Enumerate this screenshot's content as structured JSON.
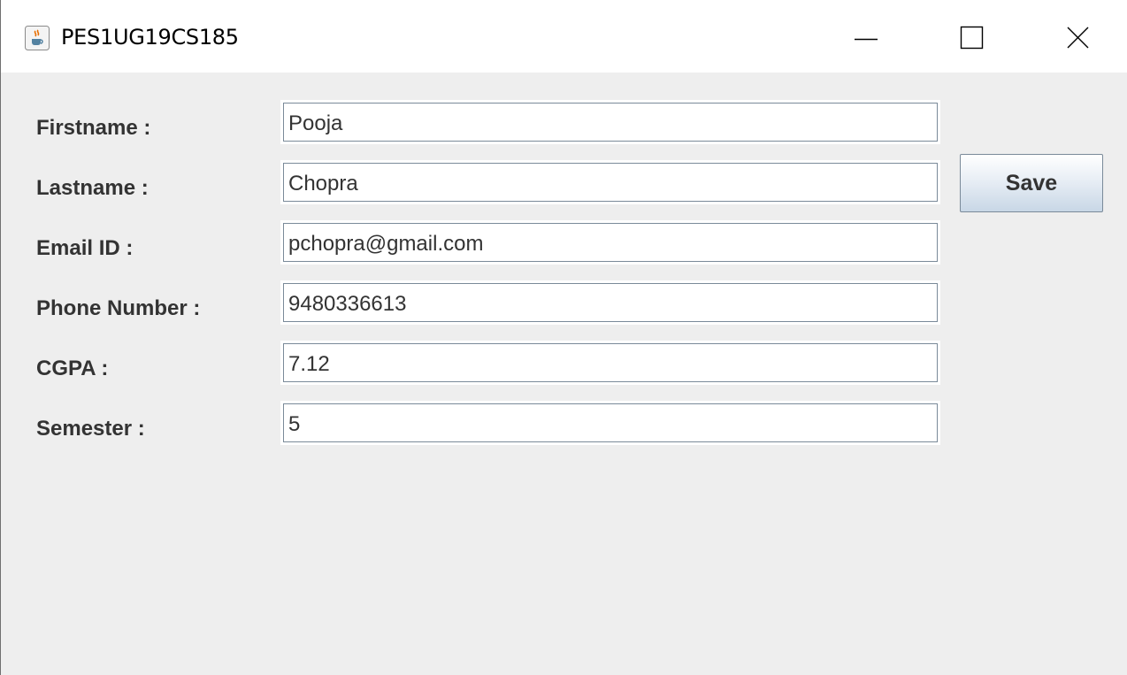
{
  "window": {
    "title": "PES1UG19CS185",
    "app_icon": "java-coffee-cup-icon",
    "controls": [
      "minimize-icon",
      "maximize-icon",
      "close-icon"
    ]
  },
  "form": {
    "fields": [
      {
        "label": "Firstname :",
        "value": "Pooja"
      },
      {
        "label": "Lastname :",
        "value": "Chopra"
      },
      {
        "label": "Email ID :",
        "value": "pchopra@gmail.com"
      },
      {
        "label": "Phone Number :",
        "value": "9480336613"
      },
      {
        "label": "CGPA :",
        "value": "7.12"
      },
      {
        "label": "Semester :",
        "value": "5"
      }
    ],
    "save_label": "Save"
  },
  "colors": {
    "panel_background": "#eeeeee",
    "label_text": "#333333",
    "field_border": "#7a8a99",
    "button_gradient_bottom": "#c8d7e6"
  }
}
